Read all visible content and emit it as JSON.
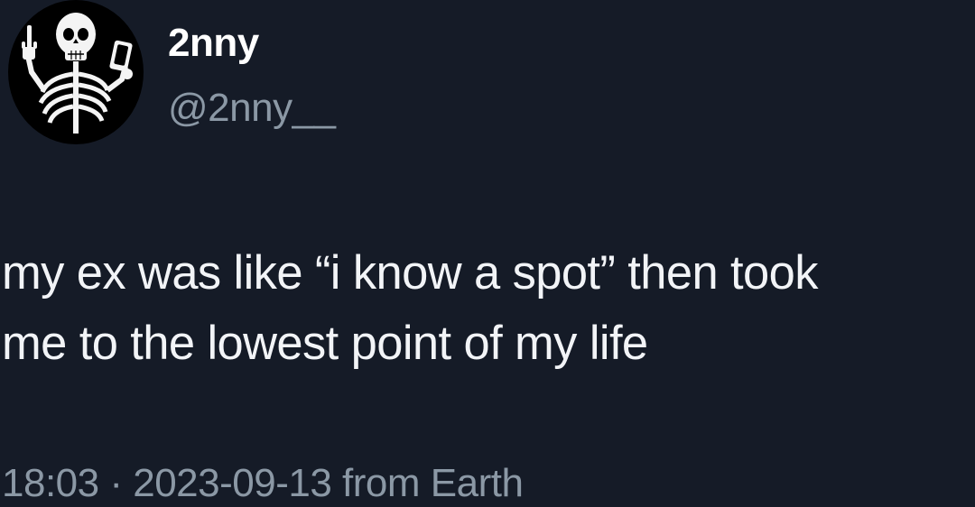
{
  "tweet": {
    "author": {
      "display_name": "2nny",
      "handle": "@2nny__",
      "avatar_icon": "skeleton-middle-finger-avatar-icon"
    },
    "text_line_1": "my ex was like “i know a spot” then took",
    "text_line_2": "me to the lowest point of my life",
    "meta": {
      "time": "18:03",
      "separator": " · ",
      "date": "2023-09-13",
      "source": " from Earth"
    }
  },
  "colors": {
    "background": "#151b27",
    "text_primary": "#ffffff",
    "text_secondary": "#8b98a5"
  }
}
